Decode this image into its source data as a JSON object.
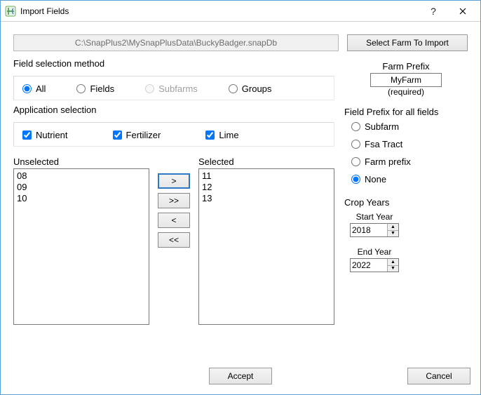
{
  "window": {
    "title": "Import Fields"
  },
  "filepath": "C:\\SnapPlus2\\MySnapPlusData\\BuckyBadger.snapDb",
  "select_farm_label": "Select Farm To Import",
  "field_selection": {
    "label": "Field selection method",
    "options": {
      "all": "All",
      "fields": "Fields",
      "subfarms": "Subfarms",
      "groups": "Groups"
    },
    "checked": "all",
    "disabled": "subfarms"
  },
  "app_selection": {
    "label": "Application selection",
    "nutrient": "Nutrient",
    "fertilizer": "Fertilizer",
    "lime": "Lime"
  },
  "lists": {
    "unselected_label": "Unselected",
    "selected_label": "Selected",
    "unselected": [
      "08",
      "09",
      "10"
    ],
    "selected": [
      "11",
      "12",
      "13"
    ]
  },
  "movers": {
    "right": ">",
    "right_all": ">>",
    "left": "<",
    "left_all": "<<"
  },
  "farm_prefix": {
    "label": "Farm Prefix",
    "value": "MyFarm",
    "required": "(required)"
  },
  "field_prefix": {
    "label": "Field Prefix for all fields",
    "subfarm": "Subfarm",
    "fsatract": "Fsa Tract",
    "farmprefix": "Farm prefix",
    "none": "None",
    "checked": "none"
  },
  "crop_years": {
    "label": "Crop Years",
    "start_label": "Start Year",
    "start_value": "2018",
    "end_label": "End Year",
    "end_value": "2022"
  },
  "buttons": {
    "accept": "Accept",
    "cancel": "Cancel"
  }
}
